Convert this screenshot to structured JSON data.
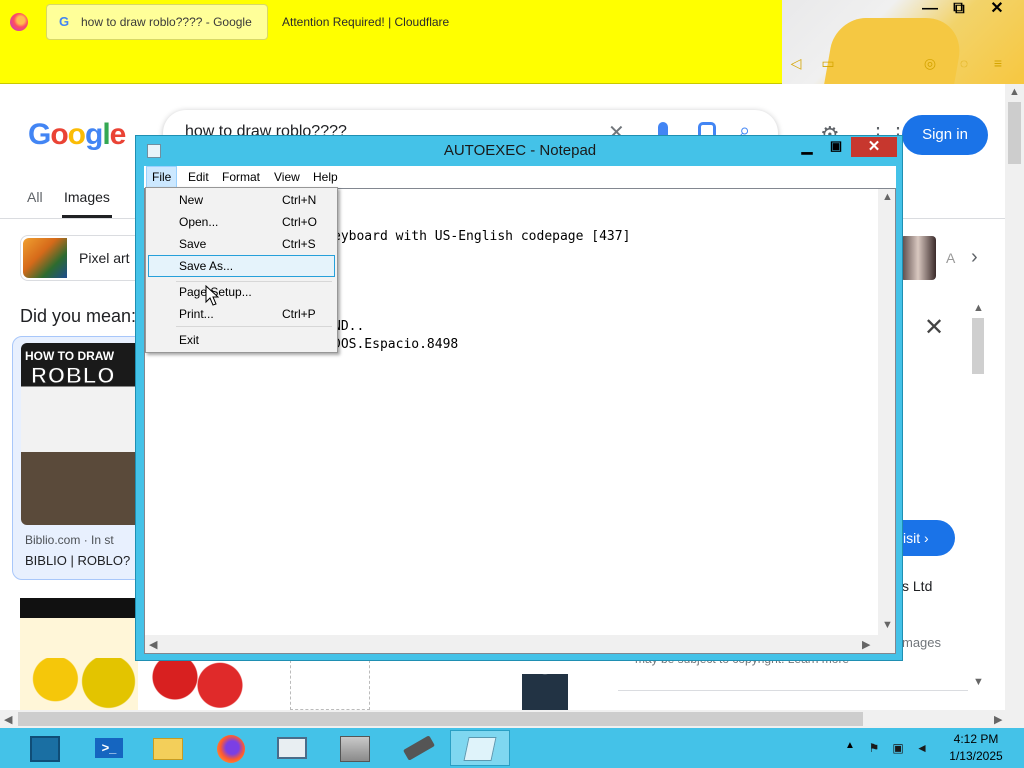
{
  "browser": {
    "tabs": [
      {
        "label": "how to draw roblo???? - Google"
      },
      {
        "label": "Attention Required! | Cloudflare"
      }
    ],
    "window_controls": {
      "minimize": "—",
      "maximize": "⧉",
      "close": "✕"
    }
  },
  "google": {
    "logo": [
      "G",
      "o",
      "o",
      "g",
      "l",
      "e"
    ],
    "logo_colors": [
      "#4285f4",
      "#ea4335",
      "#fbbc05",
      "#4285f4",
      "#34a853",
      "#ea4335"
    ],
    "search_text": "how to draw roblo????",
    "sign_in": "Sign in",
    "tabs": {
      "all": "All",
      "images": "Images"
    },
    "chip_label": "Pixel art",
    "did_you_mean": "Did you mean:",
    "card1": {
      "headline": "HOW TO DRAW",
      "roblox_text": "ROBLO",
      "source": "Biblio.com · In st",
      "title": "BIBLIO | ROBLO?"
    },
    "panel": {
      "visit": "isit ›",
      "ltd": "s Ltd",
      "images_may": "mages",
      "copyright": "may be subject to copyright. Learn more"
    },
    "chevron_right": "›"
  },
  "notepad": {
    "title": "AUTOEXEC - Notepad",
    "menu": {
      "file": "File",
      "edit": "Edit",
      "format": "Format",
      "view": "View",
      "help": "Help"
    },
    "lines": [
      "eyboard with US-English codepage [437]",
      "ND..",
      "DOS.Espacio.8498"
    ],
    "file_menu": [
      {
        "label": "New",
        "shortcut": "Ctrl+N"
      },
      {
        "label": "Open...",
        "shortcut": "Ctrl+O"
      },
      {
        "label": "Save",
        "shortcut": "Ctrl+S"
      },
      {
        "label": "Save As...",
        "shortcut": ""
      },
      {
        "label": "Page Setup...",
        "shortcut": ""
      },
      {
        "label": "Print...",
        "shortcut": "Ctrl+P"
      },
      {
        "label": "Exit",
        "shortcut": ""
      }
    ]
  },
  "taskbar": {
    "apps": [
      "start",
      "powershell",
      "file-explorer",
      "firefox",
      "control-panel",
      "server-manager",
      "usb-drive",
      "notepad"
    ],
    "time": "4:12 PM",
    "date": "1/13/2025",
    "powershell_glyph": ">_"
  }
}
